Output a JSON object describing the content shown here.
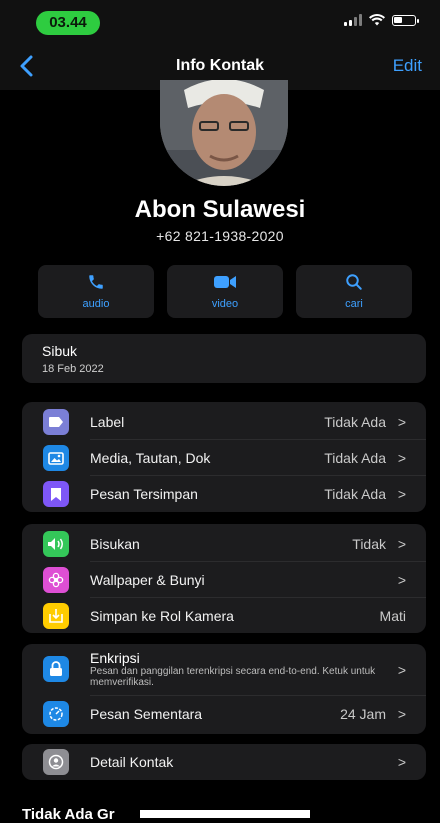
{
  "status_bar": {
    "time": "03.44"
  },
  "nav": {
    "title": "Info Kontak",
    "edit_label": "Edit"
  },
  "contact": {
    "name": "Abon Sulawesi",
    "phone": "+62 821-1938-2020"
  },
  "actions": [
    {
      "label": "audio",
      "icon": "phone-icon"
    },
    {
      "label": "video",
      "icon": "video-icon"
    },
    {
      "label": "cari",
      "icon": "search-icon"
    }
  ],
  "status": {
    "title": "Sibuk",
    "date": "18 Feb 2022"
  },
  "group1": [
    {
      "label": "Label",
      "value": "Tidak Ada",
      "icon": "tag-icon",
      "color": "#7b7fd6"
    },
    {
      "label": "Media, Tautan, Dok",
      "value": "Tidak Ada",
      "icon": "photo-icon",
      "color": "#1e88e5"
    },
    {
      "label": "Pesan Tersimpan",
      "value": "Tidak Ada",
      "icon": "bookmark-icon",
      "color": "#7e57f7"
    }
  ],
  "group2": [
    {
      "label": "Bisukan",
      "value": "Tidak",
      "icon": "speaker-icon",
      "color": "#34c759"
    },
    {
      "label": "Wallpaper & Bunyi",
      "value": "",
      "icon": "flower-icon",
      "color": "#de4fd4"
    },
    {
      "label": "Simpan ke Rol Kamera",
      "value": "Mati",
      "icon": "download-icon",
      "color": "#ffcc00"
    }
  ],
  "group3": {
    "encryption_title": "Enkripsi",
    "encryption_desc": "Pesan dan panggilan terenkripsi secara end-to-end. Ketuk untuk memverifikasi.",
    "temp_label": "Pesan Sementara",
    "temp_value": "24 Jam"
  },
  "group4": {
    "label": "Detail Kontak"
  },
  "footer": {
    "title": "Tidak Ada Gr"
  },
  "colors": {
    "accent": "#3ea0ff",
    "background": "#000000",
    "card": "#1c1c1e"
  }
}
